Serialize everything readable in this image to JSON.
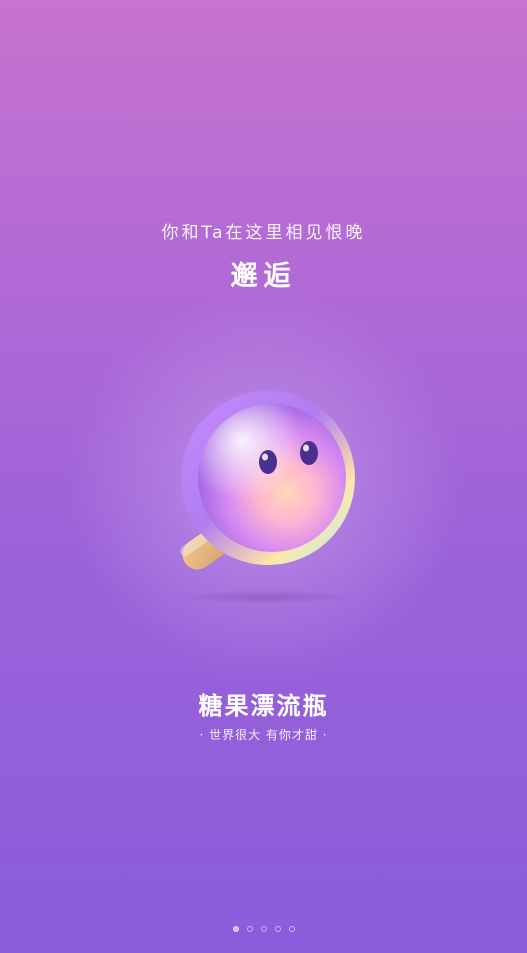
{
  "splash": {
    "tagline": "你和Ta在这里相见恨晚",
    "headline": "邂逅",
    "app_name": "糖果漂流瓶",
    "slogan": "· 世界很大 有你才甜 ·",
    "mascot_icon": "candy-lollipop-mascot-icon"
  },
  "pagination": {
    "count": 5,
    "active_index": 0
  },
  "colors": {
    "bg_top": "#c873cf",
    "bg_bottom": "#8a5ddb",
    "text": "#ffffff"
  }
}
